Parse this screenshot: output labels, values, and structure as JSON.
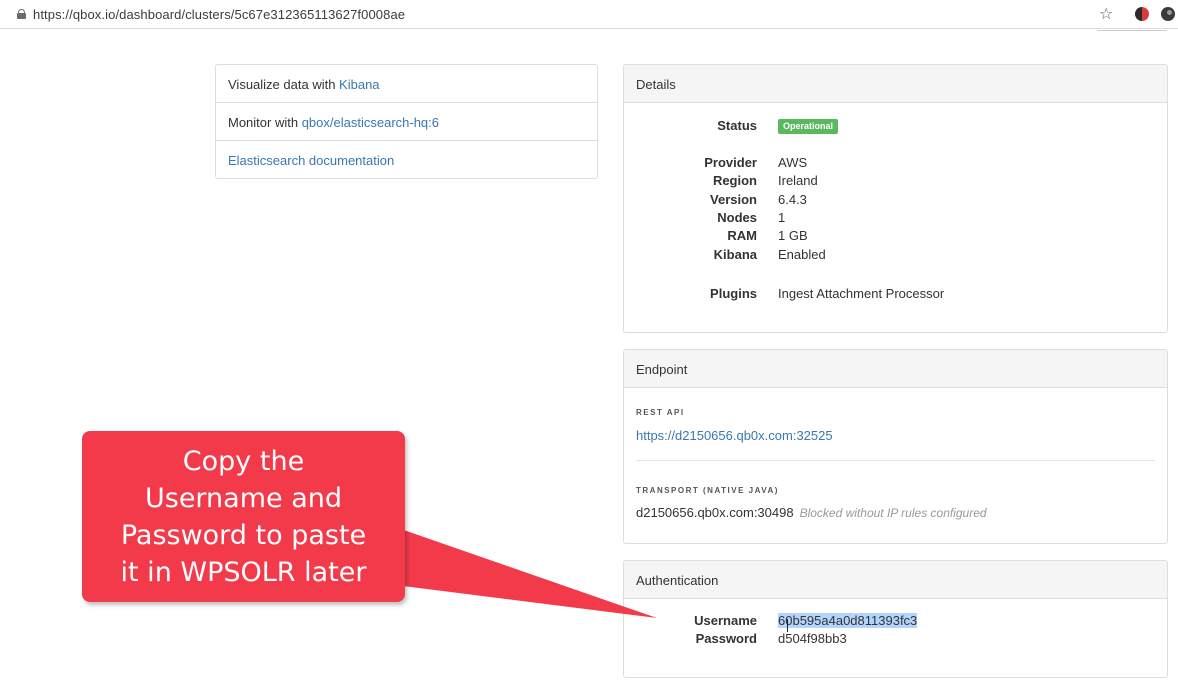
{
  "browser": {
    "url": "https://qbox.io/dashboard/clusters/5c67e312365113627f0008ae",
    "star_glyph": "☆"
  },
  "links": {
    "items": [
      {
        "prefix": "Visualize data with ",
        "link": "Kibana"
      },
      {
        "prefix": "Monitor with ",
        "link": "qbox/elasticsearch-hq:6"
      },
      {
        "prefix": "",
        "link": "Elasticsearch documentation"
      }
    ]
  },
  "details": {
    "heading": "Details",
    "status_label": "Status",
    "status_value": "Operational",
    "rows": [
      {
        "label": "Provider",
        "value": "AWS"
      },
      {
        "label": "Region",
        "value": "Ireland"
      },
      {
        "label": "Version",
        "value": "6.4.3"
      },
      {
        "label": "Nodes",
        "value": "1"
      },
      {
        "label": "RAM",
        "value": "1 GB"
      },
      {
        "label": "Kibana",
        "value": "Enabled"
      }
    ],
    "plugins_label": "Plugins",
    "plugins_value": "Ingest Attachment Processor"
  },
  "endpoint": {
    "heading": "Endpoint",
    "rest_label": "REST API",
    "rest_url": "https://d2150656.qb0x.com:32525",
    "transport_label": "TRANSPORT (NATIVE JAVA)",
    "transport_value": "d2150656.qb0x.com:30498",
    "transport_note": "Blocked without IP rules configured"
  },
  "auth": {
    "heading": "Authentication",
    "username_label": "Username",
    "username_value": "60b595a4a0d811393fc3",
    "password_label": "Password",
    "password_value": "d504f98bb3"
  },
  "callout": {
    "lines": [
      "Copy the",
      "Username and",
      "Password to paste",
      "it in WPSOLR later"
    ],
    "color": "#f23a4b"
  }
}
